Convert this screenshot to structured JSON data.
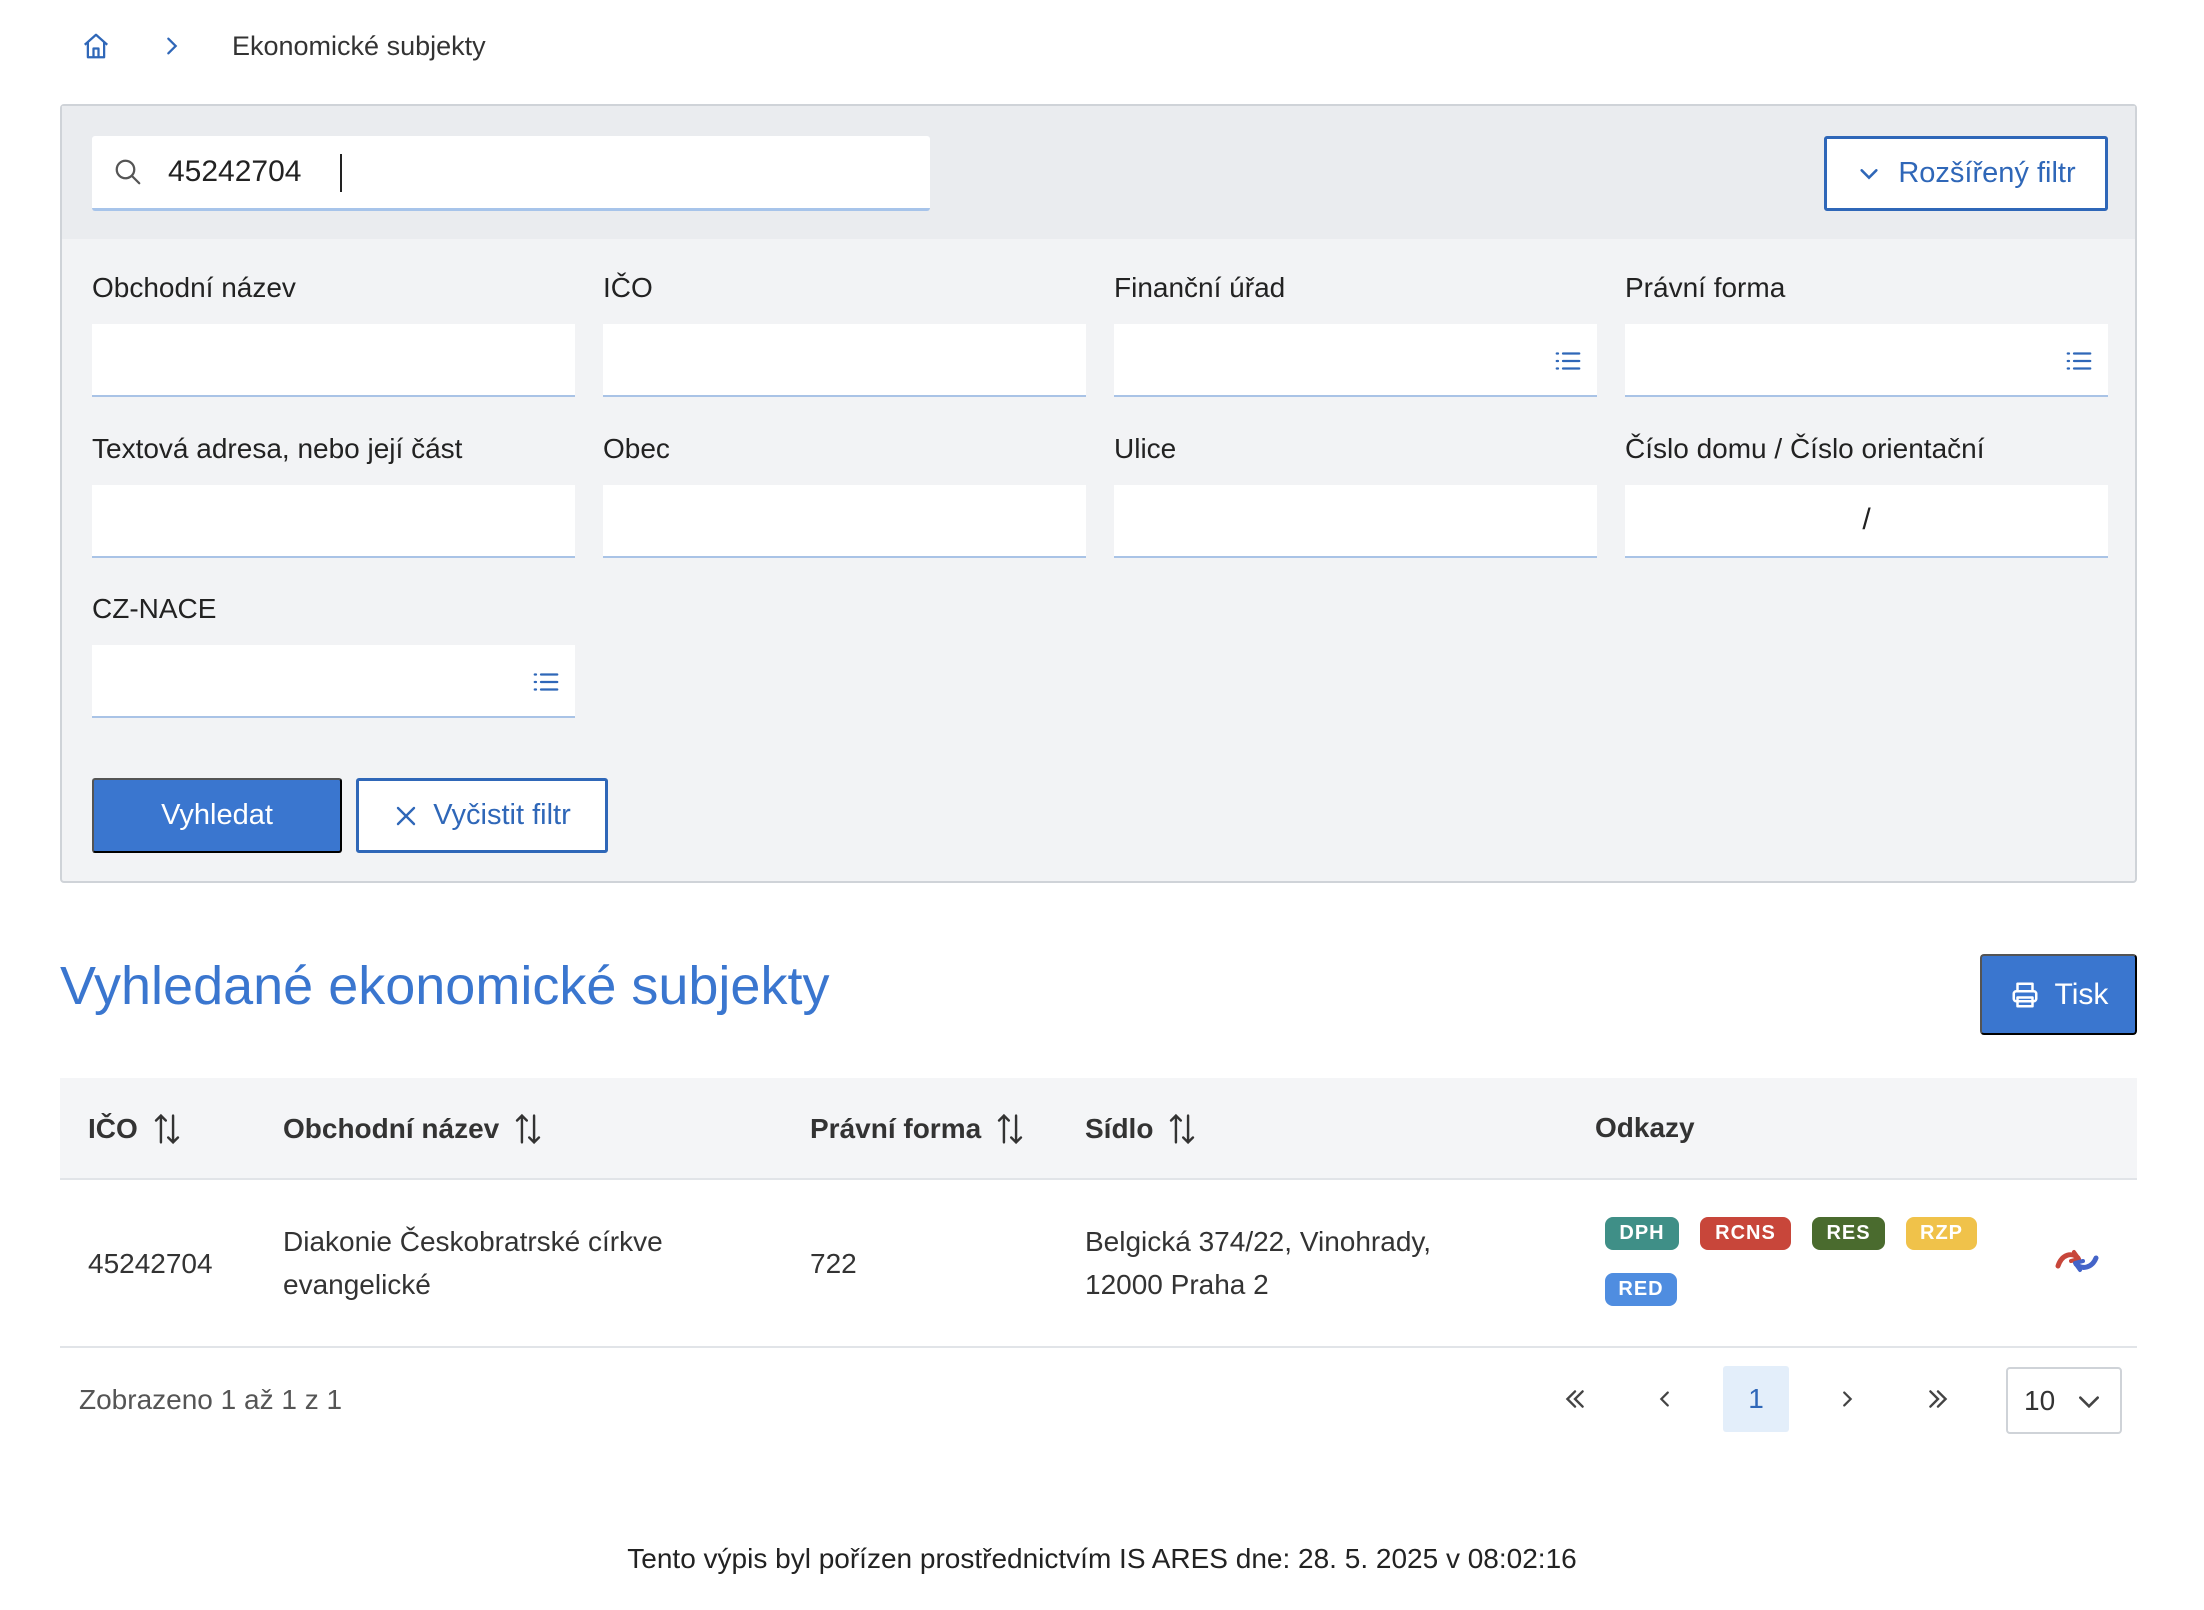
{
  "breadcrumb": {
    "current": "Ekonomické subjekty"
  },
  "search": {
    "value": "45242704"
  },
  "filter": {
    "advanced_label": "Rozšířený filtr",
    "fields": {
      "obchodni_nazev": "Obchodní název",
      "ico": "IČO",
      "financni_urad": "Finanční úřad",
      "pravni_forma": "Právní forma",
      "textova_adresa": "Textová adresa, nebo její část",
      "obec": "Obec",
      "ulice": "Ulice",
      "cislo_domu": "Číslo domu / Číslo orientační",
      "cislo_separator": "/",
      "cz_nace": "CZ-NACE"
    },
    "search_button": "Vyhledat",
    "clear_button": "Vyčistit filtr"
  },
  "results": {
    "title": "Vyhledané ekonomické subjekty",
    "print_button": "Tisk",
    "columns": {
      "ico": "IČO",
      "nazev": "Obchodní název",
      "forma": "Právní forma",
      "sidlo": "Sídlo",
      "odkazy": "Odkazy"
    },
    "rows": [
      {
        "ico": "45242704",
        "nazev_line1": "Diakonie Českobratrské církve",
        "nazev_line2": "evangelické",
        "forma": "722",
        "sidlo_line1": "Belgická 374/22, Vinohrady,",
        "sidlo_line2": "12000 Praha 2",
        "badges": [
          {
            "label": "DPH",
            "color": "#3f8f87"
          },
          {
            "label": "RCNS",
            "color": "#c8463a"
          },
          {
            "label": "RES",
            "color": "#4a6b2e"
          },
          {
            "label": "RZP",
            "color": "#f0c24a"
          },
          {
            "label": "RED",
            "color": "#4f8de0"
          }
        ]
      }
    ]
  },
  "pagination": {
    "info": "Zobrazeno 1 až 1 z 1",
    "first": "«",
    "prev": "‹",
    "current": "1",
    "next": "›",
    "last": "»",
    "page_size": "10"
  },
  "footer": {
    "text": "Tento výpis byl pořízen prostřednictvím IS ARES dne: 28. 5. 2025 v 08:02:16"
  },
  "colors": {
    "accent": "#3a76cf",
    "accent_dark": "#2f67b8"
  }
}
